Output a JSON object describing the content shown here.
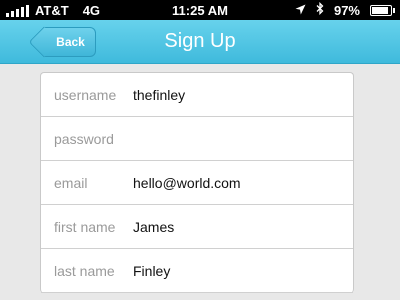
{
  "status_bar": {
    "carrier": "AT&T",
    "network": "4G",
    "time": "11:25 AM",
    "battery_percent": "97%",
    "battery_level": 0.97,
    "signal_bars": 5,
    "icons": [
      "location-icon",
      "bluetooth-icon",
      "battery-icon"
    ]
  },
  "nav": {
    "back_label": "Back",
    "title": "Sign Up"
  },
  "form": {
    "fields": [
      {
        "label": "username",
        "value": "thefinley"
      },
      {
        "label": "password",
        "value": ""
      },
      {
        "label": "email",
        "value": "hello@world.com"
      },
      {
        "label": "first name",
        "value": "James"
      },
      {
        "label": "last name",
        "value": "Finley"
      }
    ]
  },
  "colors": {
    "nav_bar": "#4cc3e2",
    "background": "#e8e8e8",
    "label_text": "#9a9a9a"
  }
}
